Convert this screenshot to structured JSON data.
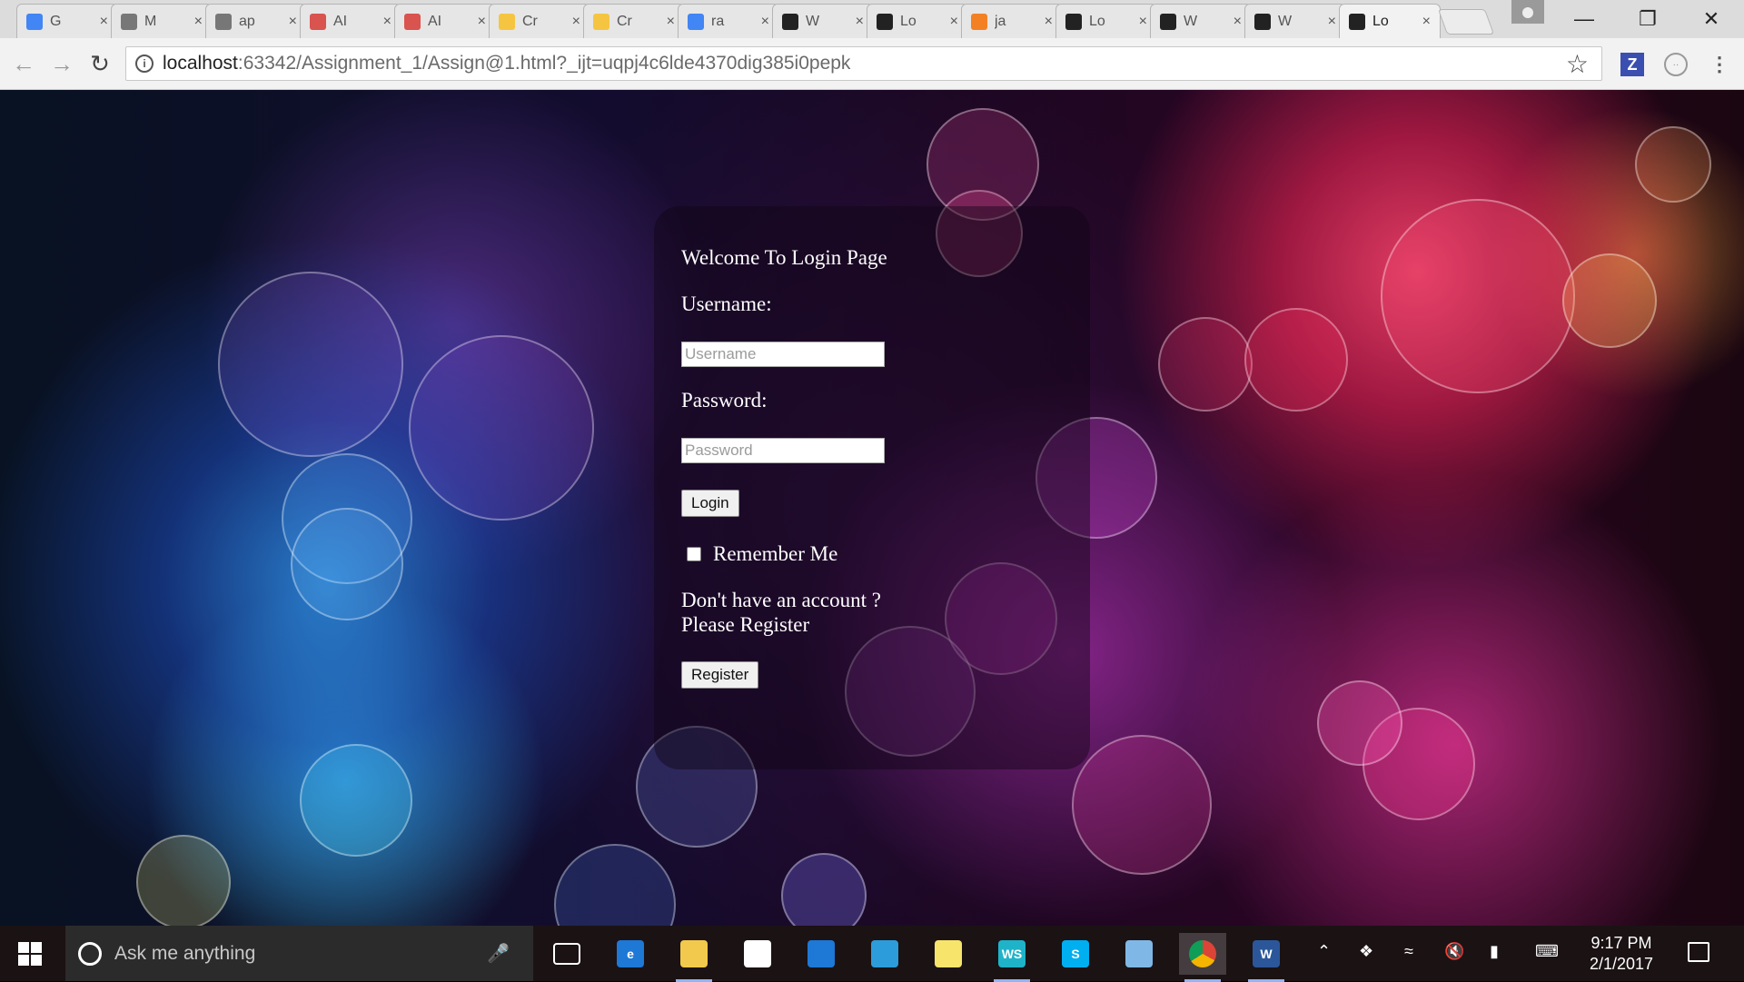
{
  "browser": {
    "tabs": [
      {
        "title": "G",
        "icon": "google-apps-icon",
        "color": "#4285f4"
      },
      {
        "title": "M",
        "icon": "document-icon",
        "color": "#777777"
      },
      {
        "title": "ap",
        "icon": "document-icon",
        "color": "#777777"
      },
      {
        "title": "AI",
        "icon": "analytics-icon",
        "color": "#d9534f"
      },
      {
        "title": "AI",
        "icon": "analytics-icon",
        "color": "#d9534f"
      },
      {
        "title": "Cr",
        "icon": "lightbulb-icon",
        "color": "#f5c542"
      },
      {
        "title": "Cr",
        "icon": "lightbulb-icon",
        "color": "#f5c542"
      },
      {
        "title": "ra",
        "icon": "google-icon",
        "color": "#4285f4"
      },
      {
        "title": "W",
        "icon": "webstorm-icon",
        "color": "#222222"
      },
      {
        "title": "Lo",
        "icon": "webstorm-icon",
        "color": "#222222"
      },
      {
        "title": "ja",
        "icon": "stack-icon",
        "color": "#f48024"
      },
      {
        "title": "Lo",
        "icon": "webstorm-icon",
        "color": "#222222"
      },
      {
        "title": "W",
        "icon": "webstorm-icon",
        "color": "#222222"
      },
      {
        "title": "W",
        "icon": "webstorm-icon",
        "color": "#222222"
      },
      {
        "title": "Lo",
        "icon": "webstorm-icon",
        "color": "#222222",
        "active": true
      }
    ],
    "close_glyph": "×",
    "url_host": "localhost",
    "url_rest": ":63342/Assignment_1/Assign@1.html?_ijt=uqpj4c6lde4370dig385i0pepk"
  },
  "login": {
    "welcome": "Welcome To Login Page",
    "username_label": "Username:",
    "username_placeholder": "Username",
    "password_label": "Password:",
    "password_placeholder": "Password",
    "login_button": "Login",
    "remember_label": "Remember Me",
    "no_account_line1": "Don't have an account ?",
    "no_account_line2": "Please Register",
    "register_button": "Register"
  },
  "taskbar": {
    "search_placeholder": "Ask me anything",
    "apps": [
      {
        "name": "task-view-icon",
        "label": ""
      },
      {
        "name": "edge-icon",
        "label": "e",
        "color": "#1e78d6"
      },
      {
        "name": "file-explorer-icon",
        "label": "",
        "color": "#f2c94c"
      },
      {
        "name": "store-icon",
        "label": "",
        "color": "#ffffff"
      },
      {
        "name": "shark-app-icon",
        "label": "",
        "color": "#1e78d6"
      },
      {
        "name": "remote-app-icon",
        "label": "",
        "color": "#2d9cdb"
      },
      {
        "name": "sticky-notes-icon",
        "label": "",
        "color": "#f7e46b"
      },
      {
        "name": "webstorm-icon",
        "label": "WS",
        "color": "#1fb3c9"
      },
      {
        "name": "skype-icon",
        "label": "S",
        "color": "#00aff0"
      },
      {
        "name": "notepad-icon",
        "label": "",
        "color": "#7fb8e6"
      },
      {
        "name": "chrome-icon",
        "label": "",
        "color": "#db4437"
      },
      {
        "name": "word-icon",
        "label": "W",
        "color": "#2b579a"
      }
    ],
    "time": "9:17 PM",
    "date": "2/1/2017"
  }
}
